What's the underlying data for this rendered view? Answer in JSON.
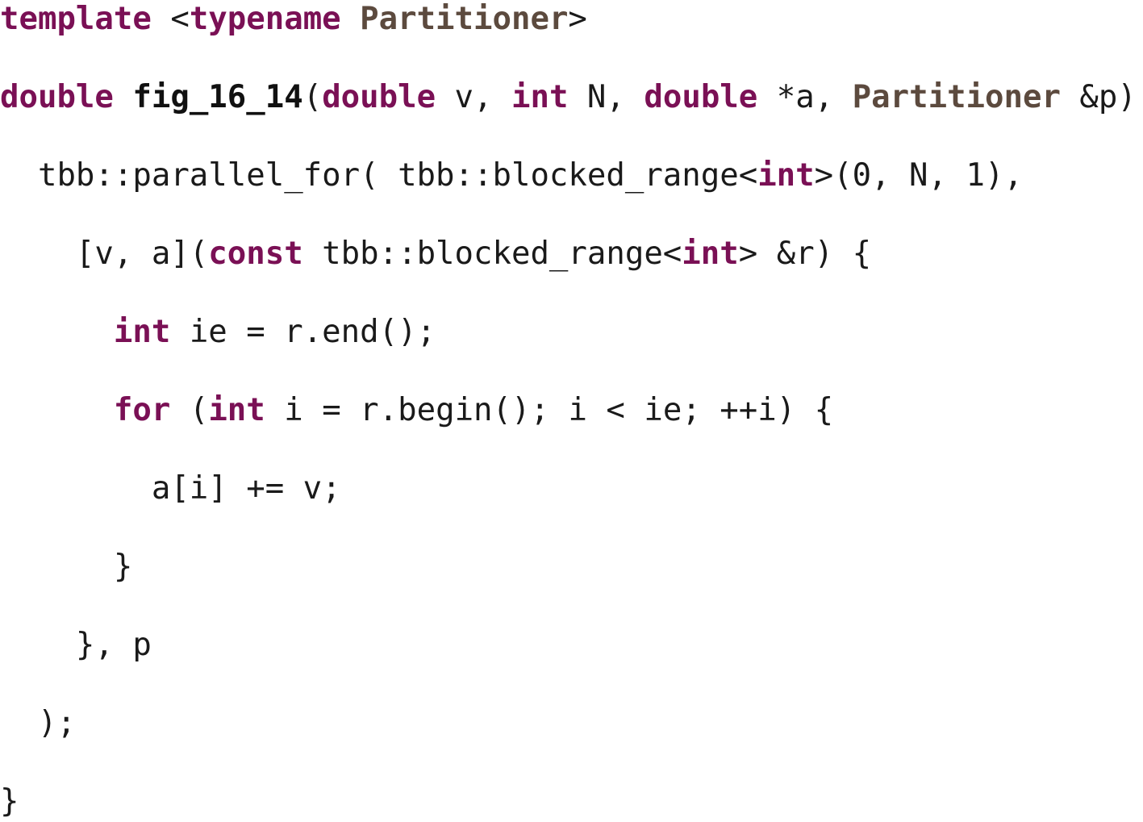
{
  "code": {
    "lines": [
      [
        {
          "t": "template",
          "k": "kw"
        },
        {
          "t": " <",
          "k": "tx"
        },
        {
          "t": "typename",
          "k": "kw"
        },
        {
          "t": " ",
          "k": "tx"
        },
        {
          "t": "Partitioner",
          "k": "ty"
        },
        {
          "t": ">",
          "k": "tx"
        }
      ],
      [
        {
          "t": "double",
          "k": "kw"
        },
        {
          "t": " ",
          "k": "tx"
        },
        {
          "t": "fig_16_14",
          "k": "fn"
        },
        {
          "t": "(",
          "k": "tx"
        },
        {
          "t": "double",
          "k": "kw"
        },
        {
          "t": " v, ",
          "k": "tx"
        },
        {
          "t": "int",
          "k": "kw"
        },
        {
          "t": " N, ",
          "k": "tx"
        },
        {
          "t": "double",
          "k": "kw"
        },
        {
          "t": " *a, ",
          "k": "tx"
        },
        {
          "t": "Partitioner",
          "k": "ty"
        },
        {
          "t": " &p) {",
          "k": "tx"
        }
      ],
      [
        {
          "t": "  tbb::parallel_for( tbb::blocked_range<",
          "k": "tx"
        },
        {
          "t": "int",
          "k": "kw"
        },
        {
          "t": ">(0, N, 1),",
          "k": "tx"
        }
      ],
      [
        {
          "t": "    [v, a](",
          "k": "tx"
        },
        {
          "t": "const",
          "k": "kw"
        },
        {
          "t": " tbb::blocked_range<",
          "k": "tx"
        },
        {
          "t": "int",
          "k": "kw"
        },
        {
          "t": "> &r) {",
          "k": "tx"
        }
      ],
      [
        {
          "t": "      ",
          "k": "tx"
        },
        {
          "t": "int",
          "k": "kw"
        },
        {
          "t": " ie = r.end();",
          "k": "tx"
        }
      ],
      [
        {
          "t": "      ",
          "k": "tx"
        },
        {
          "t": "for",
          "k": "kw"
        },
        {
          "t": " (",
          "k": "tx"
        },
        {
          "t": "int",
          "k": "kw"
        },
        {
          "t": " i = r.begin(); i < ie; ++i) {",
          "k": "tx"
        }
      ],
      [
        {
          "t": "        a[i] += v;",
          "k": "tx"
        }
      ],
      [
        {
          "t": "      }",
          "k": "tx"
        }
      ],
      [
        {
          "t": "    }, p",
          "k": "tx"
        }
      ],
      [
        {
          "t": "  );",
          "k": "tx"
        }
      ],
      [
        {
          "t": "}",
          "k": "tx"
        }
      ]
    ]
  }
}
